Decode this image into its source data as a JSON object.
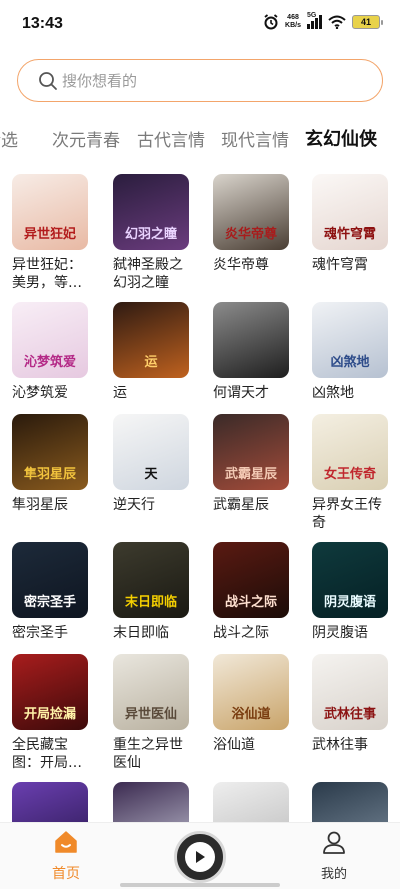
{
  "status_bar": {
    "time": "13:43",
    "speed_value": "468",
    "speed_unit": "KB/s",
    "network": "5G",
    "battery": "41"
  },
  "search": {
    "placeholder": "搜你想看的"
  },
  "tabs": [
    {
      "label": "精选",
      "active": false
    },
    {
      "label": "次元青春",
      "active": false
    },
    {
      "label": "古代言情",
      "active": false
    },
    {
      "label": "现代言情",
      "active": false
    },
    {
      "label": "玄幻仙侠",
      "active": true
    }
  ],
  "books": [
    {
      "title": "异世狂妃：美男，等…",
      "cover_text": "异世狂妃",
      "bg": [
        "#f7ece6",
        "#e8b9a4"
      ],
      "fg": "#b21b1b"
    },
    {
      "title": "弑神圣殿之幻羽之瞳",
      "cover_text": "幻羽之瞳",
      "bg": [
        "#2a1d3d",
        "#6b3c7e"
      ],
      "fg": "#e9d3ff"
    },
    {
      "title": "炎华帝尊",
      "cover_text": "炎华帝尊",
      "bg": [
        "#d9d4cc",
        "#4a3e34"
      ],
      "fg": "#a81c1c"
    },
    {
      "title": "魂忤穹霄",
      "cover_text": "魂忤穹霄",
      "bg": [
        "#fbf8f6",
        "#e5d6d0"
      ],
      "fg": "#8d1010"
    },
    {
      "title": "沁梦筑爱",
      "cover_text": "沁梦筑爱",
      "bg": [
        "#f8eef6",
        "#e6c9e0"
      ],
      "fg": "#b42a87"
    },
    {
      "title": "运",
      "cover_text": "运",
      "bg": [
        "#2e1a12",
        "#c0621f"
      ],
      "fg": "#ffcf6a"
    },
    {
      "title": "何谓天才",
      "cover_text": "",
      "bg": [
        "#8c8c8c",
        "#1e1e1e"
      ],
      "fg": "#ffffff"
    },
    {
      "title": "凶煞地",
      "cover_text": "凶煞地",
      "bg": [
        "#f0f2f5",
        "#b6c1d1"
      ],
      "fg": "#2e4c8a"
    },
    {
      "title": "隼羽星辰",
      "cover_text": "隼羽星辰",
      "bg": [
        "#2a1a0c",
        "#8a5b1e"
      ],
      "fg": "#f1c33d"
    },
    {
      "title": "逆天行",
      "cover_text": "天",
      "bg": [
        "#f6f6f6",
        "#cfd6df"
      ],
      "fg": "#111111"
    },
    {
      "title": "武霸星辰",
      "cover_text": "武霸星辰",
      "bg": [
        "#3a2a28",
        "#a44c3a"
      ],
      "fg": "#f3c9b4"
    },
    {
      "title": "异界女王传奇",
      "cover_text": "女王传奇",
      "bg": [
        "#f4efe2",
        "#d9cfb3"
      ],
      "fg": "#c0272d"
    },
    {
      "title": "密宗圣手",
      "cover_text": "密宗圣手",
      "bg": [
        "#1d2a3a",
        "#0e1520"
      ],
      "fg": "#ffffff"
    },
    {
      "title": "末日即临",
      "cover_text": "末日即临",
      "bg": [
        "#3d3b2e",
        "#1a1912"
      ],
      "fg": "#f5d000"
    },
    {
      "title": "战斗之际",
      "cover_text": "战斗之际",
      "bg": [
        "#5a1a12",
        "#1c0c08"
      ],
      "fg": "#ffe0d0"
    },
    {
      "title": "阴灵腹语",
      "cover_text": "阴灵腹语",
      "bg": [
        "#0f3a3d",
        "#052024"
      ],
      "fg": "#e9fbff"
    },
    {
      "title": "全民藏宝图：开局…",
      "cover_text": "开局捡漏",
      "bg": [
        "#a81d1d",
        "#3d0a0a"
      ],
      "fg": "#fff2a8"
    },
    {
      "title": "重生之异世医仙",
      "cover_text": "异世医仙",
      "bg": [
        "#e9e6de",
        "#b9b1a0"
      ],
      "fg": "#5a4a3a"
    },
    {
      "title": "浴仙道",
      "cover_text": "浴仙道",
      "bg": [
        "#f1e8d8",
        "#c9a46a"
      ],
      "fg": "#7a3d10"
    },
    {
      "title": "武林往事",
      "cover_text": "武林往事",
      "bg": [
        "#f5f3f0",
        "#d8d2cb"
      ],
      "fg": "#8c1414"
    },
    {
      "title": "",
      "cover_text": "",
      "bg": [
        "#6a3fb0",
        "#2a1850"
      ],
      "fg": "#ffffff"
    },
    {
      "title": "",
      "cover_text": "",
      "bg": [
        "#3b2a50",
        "#c0c0d0"
      ],
      "fg": "#ffffff"
    },
    {
      "title": "",
      "cover_text": "",
      "bg": [
        "#eeeeee",
        "#bbbbbb"
      ],
      "fg": "#222222"
    },
    {
      "title": "",
      "cover_text": "",
      "bg": [
        "#2a3a4a",
        "#7a8a9a"
      ],
      "fg": "#ffffff"
    }
  ],
  "bottom_nav": {
    "home_label": "首页",
    "mine_label": "我的"
  },
  "colors": {
    "accent": "#f08a2a",
    "search_border": "#f3a56b"
  }
}
